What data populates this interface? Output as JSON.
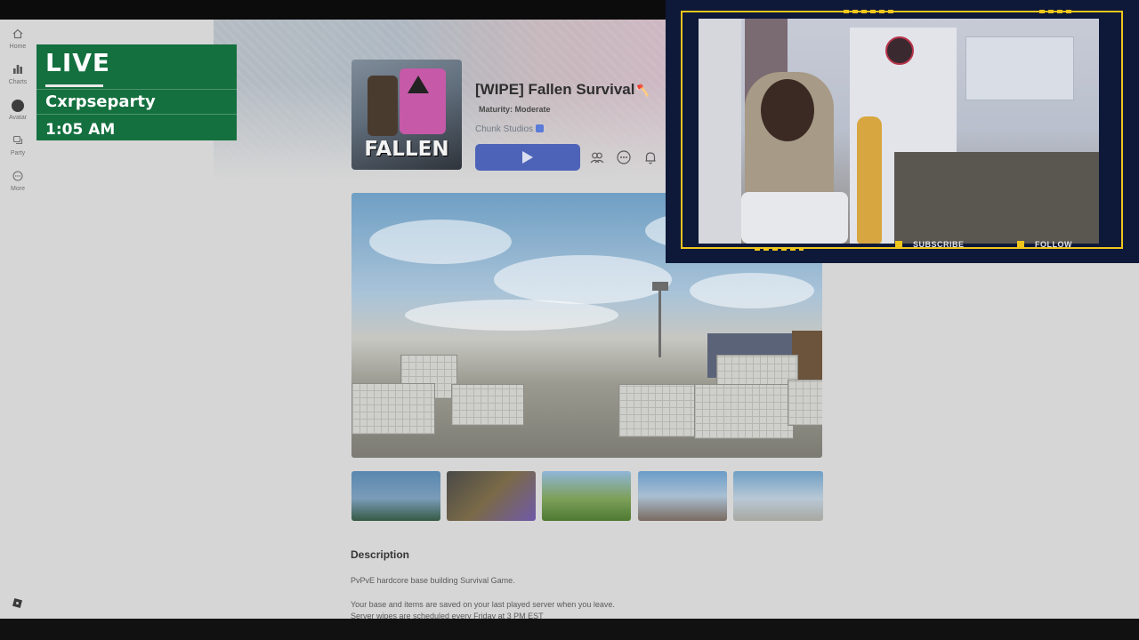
{
  "nav": {
    "items": [
      {
        "label": "Home",
        "icon": "home-icon"
      },
      {
        "label": "Charts",
        "icon": "bar-chart-icon"
      },
      {
        "label": "Avatar",
        "icon": "avatar-icon"
      },
      {
        "label": "Party",
        "icon": "party-icon"
      },
      {
        "label": "More",
        "icon": "more-icon"
      }
    ]
  },
  "overlay": {
    "live_label": "LIVE",
    "channel": "Cxrpseparty",
    "time": "1:05 AM",
    "color": "#14703f"
  },
  "game": {
    "thumbnail_text": "FALLEN",
    "title": "[WIPE] Fallen Survival",
    "title_emoji": "🪓",
    "maturity": "Maturity: Moderate",
    "creator": "Chunk Studios",
    "play_color": "#4d63b8"
  },
  "description": {
    "heading": "Description",
    "lines": [
      "PvPvE hardcore base building Survival Game.",
      "Your base and items are saved on your last played server when you leave.",
      "Server wipes are scheduled every Friday at 3 PM EST"
    ]
  },
  "webcam": {
    "subscribe": "SUBSCRIBE",
    "follow": "FOLLOW",
    "accent": "#f0c51c",
    "frame_bg": "#0e1838"
  }
}
